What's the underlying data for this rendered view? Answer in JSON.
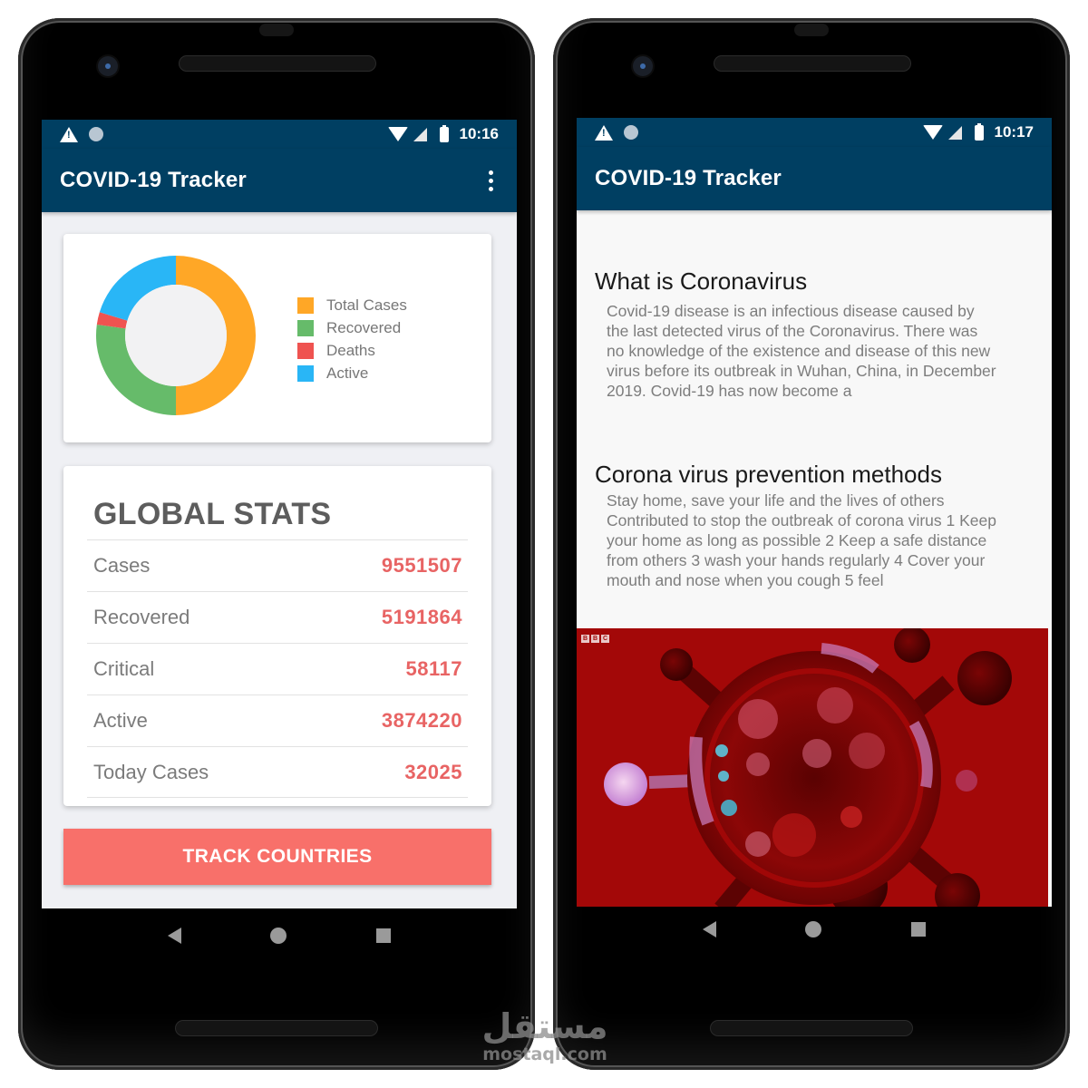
{
  "left_screen": {
    "status_bar": {
      "time": "10:16",
      "icons": [
        "warning-icon",
        "sync-icon",
        "wifi-icon",
        "signal-icon",
        "battery-icon"
      ]
    },
    "app_bar": {
      "title": "COVID-19 Tracker",
      "menu_icon": "more-vert-icon"
    },
    "chart_data": {
      "type": "pie",
      "variant": "donut",
      "title": "",
      "legend_position": "right",
      "categories": [
        "Total Cases",
        "Recovered",
        "Deaths",
        "Active"
      ],
      "values": [
        9551507,
        5191864,
        485423,
        3874220
      ],
      "colors": [
        "#ffa726",
        "#66bb6a",
        "#ef5350",
        "#29b6f6"
      ]
    },
    "legend": [
      {
        "label": "Total Cases",
        "color": "#ffa726"
      },
      {
        "label": "Recovered",
        "color": "#66bb6a"
      },
      {
        "label": "Deaths",
        "color": "#ef5350"
      },
      {
        "label": "Active",
        "color": "#29b6f6"
      }
    ],
    "global_stats": {
      "title": "GLOBAL STATS",
      "rows": [
        {
          "label": "Cases",
          "value": "9551507"
        },
        {
          "label": "Recovered",
          "value": "5191864"
        },
        {
          "label": "Critical",
          "value": "58117"
        },
        {
          "label": "Active",
          "value": "3874220"
        },
        {
          "label": "Today Cases",
          "value": "32025"
        }
      ]
    },
    "track_button": {
      "label": "TRACK COUNTRIES"
    }
  },
  "right_screen": {
    "status_bar": {
      "time": "10:17",
      "icons": [
        "warning-icon",
        "sync-icon",
        "wifi-icon",
        "signal-icon",
        "battery-icon"
      ]
    },
    "app_bar": {
      "title": "COVID-19 Tracker"
    },
    "articles": [
      {
        "heading": "What is Coronavirus",
        "body": "Covid-19 disease is an infectious disease caused by the last detected virus of the Coronavirus. There was no knowledge of the existence and disease of this new virus before its outbreak in Wuhan, China, in December 2019. Covid-19 has now become a"
      },
      {
        "heading": "Corona virus prevention methods",
        "body": "Stay home, save your life and the lives of others Contributed to stop the outbreak of corona virus 1 Keep your home as long as possible 2 Keep a safe distance from others 3 wash your hands regularly 4 Cover your mouth and nose when you cough 5 feel"
      }
    ],
    "image": {
      "description": "coronavirus-illustration",
      "logo": "BBC"
    }
  },
  "navigation": {
    "back": "back-icon",
    "home": "home-icon",
    "recents": "recents-icon"
  },
  "colors": {
    "primary": "#003f62",
    "accent": "#f8706a",
    "stat_value": "#e86464"
  },
  "watermark": {
    "arabic": "مستقل",
    "latin": "mostaql.com"
  }
}
